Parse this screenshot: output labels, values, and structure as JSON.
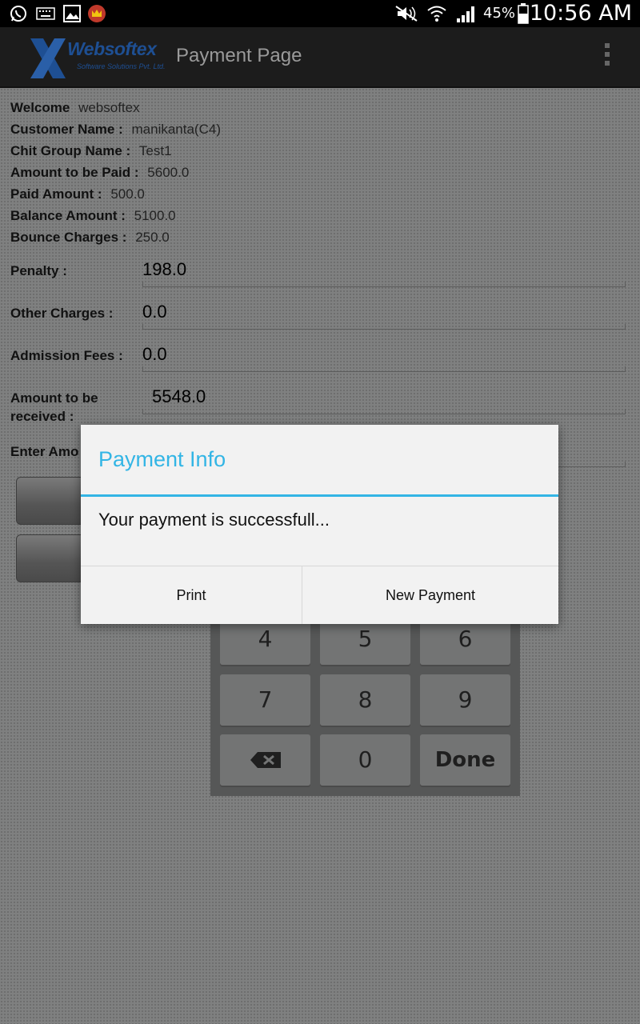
{
  "status_bar": {
    "icons": [
      "whatsapp-icon",
      "keyboard-icon",
      "image-icon",
      "crown-app-icon",
      "mute-icon",
      "wifi-icon",
      "signal-icon",
      "battery-icon"
    ],
    "battery": "45%",
    "time": "10:56 AM"
  },
  "action_bar": {
    "logo_name": "Websoftex",
    "logo_subtitle": "Software Solutions Pvt. Ltd.",
    "title": "Payment Page"
  },
  "details": {
    "welcome_label": "Welcome",
    "welcome_value": "websoftex",
    "customer_label": "Customer Name :",
    "customer_value": "manikanta(C4)",
    "chit_label": "Chit Group Name :",
    "chit_value": "Test1",
    "amount_paid_label": "Amount to be Paid :",
    "amount_paid_value": "5600.0",
    "paid_label": "Paid Amount :",
    "paid_value": "500.0",
    "balance_label": "Balance Amount :",
    "balance_value": "5100.0",
    "bounce_label": "Bounce Charges :",
    "bounce_value": "250.0"
  },
  "form": {
    "penalty_label": "Penalty :",
    "penalty_value": "198.0",
    "other_label": "Other Charges :",
    "other_value": "0.0",
    "admission_label": "Admission Fees :",
    "admission_value": "0.0",
    "received_label_line1": "Amount to be",
    "received_label_line2": "received :",
    "received_value": "5548.0",
    "enter_amount_label": "Enter Amo"
  },
  "keypad": {
    "row1": [
      "4",
      "5",
      "6"
    ],
    "row2": [
      "7",
      "8",
      "9"
    ],
    "zero": "0",
    "done": "Done"
  },
  "dialog": {
    "title": "Payment Info",
    "message": "Your payment is successfull...",
    "print_button": "Print",
    "new_payment_button": "New Payment"
  },
  "colors": {
    "accent": "#33b5e5",
    "logo_blue": "#1e4f93"
  }
}
